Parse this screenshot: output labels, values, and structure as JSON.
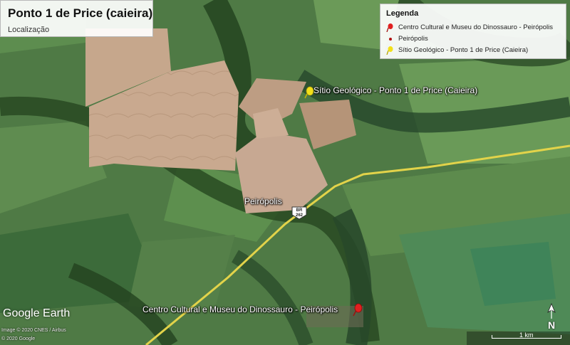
{
  "title": {
    "main": "Ponto 1 de Price (caieira)",
    "sub": "Localização"
  },
  "legend": {
    "title": "Legenda",
    "items": [
      {
        "label": "Centro Cultural e Museu do Dinossauro - Peirópolis",
        "icon": "red-pushpin-icon",
        "color": "#e02020"
      },
      {
        "label": "Peirópolis",
        "icon": "red-dot-icon",
        "color": "#b01010"
      },
      {
        "label": "Sítio Geológico - Ponto 1 de Price (Caieira)",
        "icon": "yellow-pushpin-icon",
        "color": "#f2e01a"
      }
    ]
  },
  "map_labels": {
    "sitio": "Sítio Geológico - Ponto 1 de Price (Caieira)",
    "peiropolis": "Peirópolis",
    "museu": "Centro Cultural e Museu do Dinossauro - Peirópolis"
  },
  "road_shield": {
    "line1": "BR",
    "line2": "262"
  },
  "branding": {
    "logo": "Google Earth",
    "credit1": "Image © 2020 CNES / Airbus",
    "credit2": "© 2020 Google"
  },
  "scale": {
    "label": "1 km"
  },
  "north": {
    "label": "N"
  },
  "colors": {
    "road": "#e8d84a",
    "field": "#c9a98e",
    "vegetation": "#2f5a2c",
    "pasture": "#6f9a5a"
  }
}
